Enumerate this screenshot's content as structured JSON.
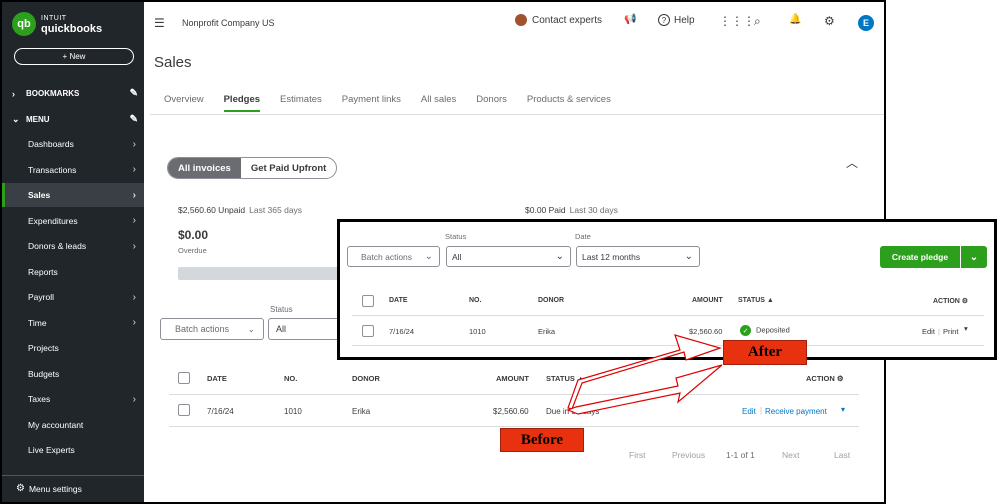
{
  "sidebar": {
    "logo_top": "INTUIT",
    "logo_bottom": "quickbooks",
    "logo_mark": "qb",
    "new_label": "+ New",
    "bookmarks_label": "BOOKMARKS",
    "menu_label": "MENU",
    "items": [
      {
        "label": "Dashboards",
        "arrow": true
      },
      {
        "label": "Transactions",
        "arrow": true
      },
      {
        "label": "Sales",
        "arrow": true,
        "active": true
      },
      {
        "label": "Expenditures",
        "arrow": true
      },
      {
        "label": "Donors & leads",
        "arrow": true
      },
      {
        "label": "Reports",
        "arrow": false
      },
      {
        "label": "Payroll",
        "arrow": true
      },
      {
        "label": "Time",
        "arrow": true
      },
      {
        "label": "Projects",
        "arrow": false
      },
      {
        "label": "Budgets",
        "arrow": false
      },
      {
        "label": "Taxes",
        "arrow": true
      },
      {
        "label": "My accountant",
        "arrow": false
      },
      {
        "label": "Live Experts",
        "arrow": false
      }
    ],
    "menu_settings": "Menu settings"
  },
  "topbar": {
    "company": "Nonprofit Company US",
    "contact_experts": "Contact experts",
    "help": "Help",
    "user_initial": "E"
  },
  "page": {
    "title": "Sales",
    "tabs": [
      "Overview",
      "Pledges",
      "Estimates",
      "Payment links",
      "All sales",
      "Donors",
      "Products & services"
    ],
    "active_tab": "Pledges",
    "toggle": {
      "on": "All invoices",
      "off": "Get Paid Upfront"
    },
    "unpaid_amount": "$2,560.60 Unpaid",
    "unpaid_period": "Last 365 days",
    "paid_amount": "$0.00 Paid",
    "paid_period": "Last 30 days",
    "overdue_amount": "$0.00",
    "overdue_label": "Overdue",
    "status_label": "Status",
    "batch_actions": "Batch actions",
    "status_value": "All",
    "columns": {
      "date": "DATE",
      "no": "NO.",
      "donor": "DONOR",
      "amount": "AMOUNT",
      "status": "STATUS ▲",
      "action": "ACTION"
    },
    "row": {
      "date": "7/16/24",
      "no": "1010",
      "donor": "Erika",
      "amount": "$2,560.60",
      "status": "Due in 30 days",
      "edit": "Edit",
      "receive": "Receive payment"
    },
    "pager": {
      "first": "First",
      "previous": "Previous",
      "range": "1-1 of 1",
      "next": "Next",
      "last": "Last"
    }
  },
  "after_panel": {
    "status_label": "Status",
    "date_label": "Date",
    "batch_actions": "Batch actions",
    "status_value": "All",
    "date_value": "Last 12 months",
    "create_pledge": "Create pledge",
    "columns": {
      "date": "DATE",
      "no": "NO.",
      "donor": "DONOR",
      "amount": "AMOUNT",
      "status": "STATUS ▲",
      "action": "ACTION"
    },
    "row": {
      "date": "7/16/24",
      "no": "1010",
      "donor": "Erika",
      "amount": "$2,560.60",
      "status": "Deposited",
      "edit": "Edit",
      "print": "Print"
    }
  },
  "annotations": {
    "after": "After",
    "before": "Before"
  },
  "colors": {
    "brand_green": "#2ca01c",
    "sidebar_bg": "#21262b",
    "link_blue": "#0077c5",
    "callout_red": "#e8310f"
  }
}
